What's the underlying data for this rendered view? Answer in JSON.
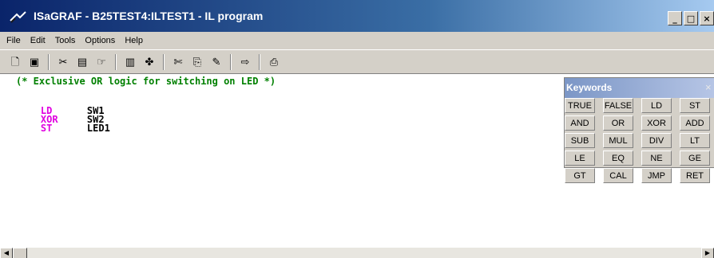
{
  "window": {
    "title": "ISaGRAF - B25TEST4:ILTEST1 - IL program"
  },
  "menu": {
    "items": [
      {
        "label": "File"
      },
      {
        "label": "Edit"
      },
      {
        "label": "Tools"
      },
      {
        "label": "Options"
      },
      {
        "label": "Help"
      }
    ]
  },
  "editor": {
    "comment": "(* Exclusive OR logic for switching on LED *)",
    "lines": [
      {
        "op": "LD",
        "operand": "SW1"
      },
      {
        "op": "XOR",
        "operand": "SW2"
      },
      {
        "op": "ST",
        "operand": "LED1"
      }
    ]
  },
  "keywords_window": {
    "title": "Keywords",
    "close_glyph": "×",
    "buttons": [
      "TRUE",
      "FALSE",
      "LD",
      "ST",
      "AND",
      "OR",
      "XOR",
      "ADD",
      "SUB",
      "MUL",
      "DIV",
      "LT",
      "LE",
      "EQ",
      "NE",
      "GE",
      "GT",
      "CAL",
      "JMP",
      "RET"
    ]
  }
}
